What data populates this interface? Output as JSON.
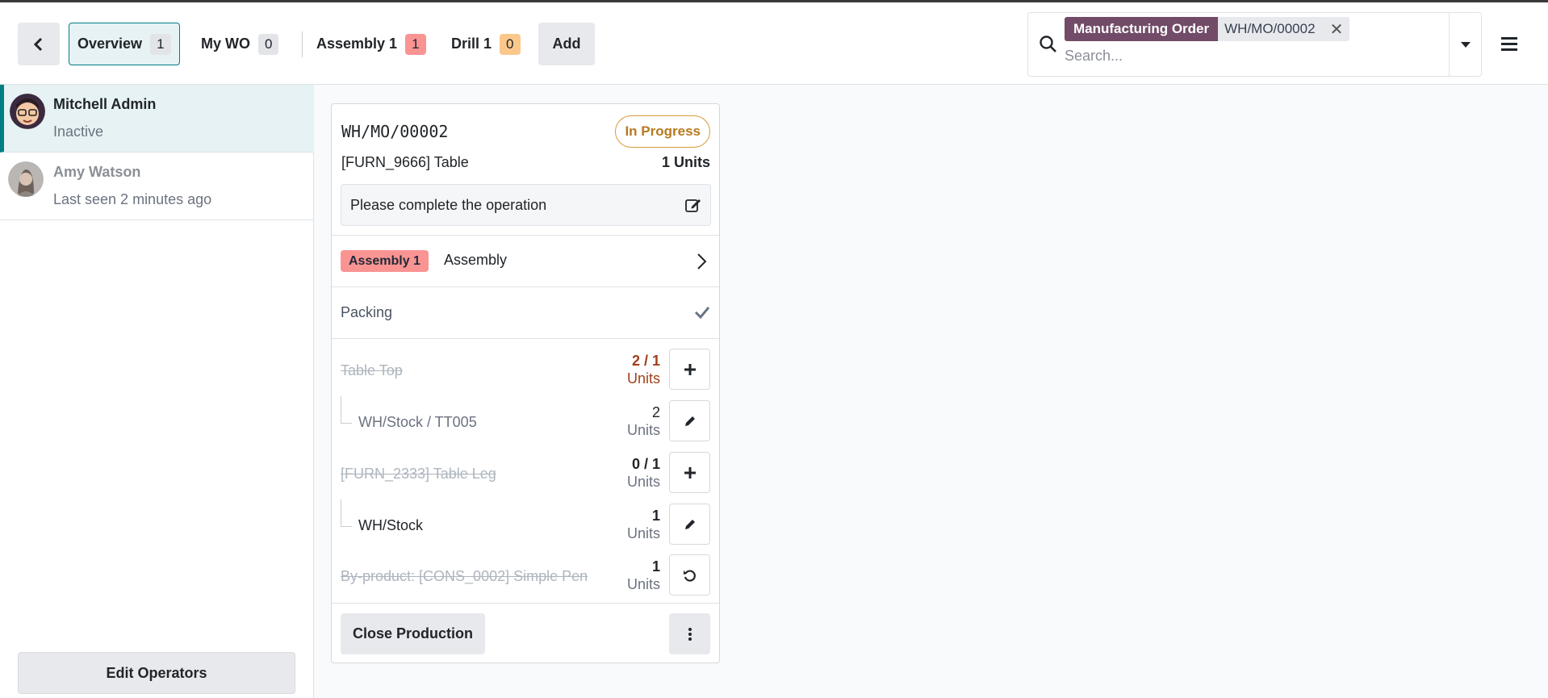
{
  "header": {
    "tabs": [
      {
        "label": "Overview",
        "count": "1"
      },
      {
        "label": "My WO",
        "count": "0"
      },
      {
        "label": "Assembly 1",
        "count": "1"
      },
      {
        "label": "Drill 1",
        "count": "0"
      }
    ],
    "add_label": "Add"
  },
  "search": {
    "facet_label": "Manufacturing Order",
    "facet_value": "WH/MO/00002",
    "placeholder": "Search..."
  },
  "operators": [
    {
      "name": "Mitchell Admin",
      "status": "Inactive"
    },
    {
      "name": "Amy Watson",
      "status": "Last seen 2 minutes ago"
    }
  ],
  "edit_operators_label": "Edit Operators",
  "card": {
    "name": "WH/MO/00002",
    "state": "In Progress",
    "product": "[FURN_9666] Table",
    "quantity": "1 Units",
    "instruction": "Please complete the operation",
    "workorder": {
      "tag": "Assembly 1",
      "name": "Assembly"
    },
    "step": "Packing",
    "components": [
      {
        "name": "Table Top",
        "qty": "2 / 1",
        "uom": "Units"
      },
      {
        "name": "WH/Stock / TT005",
        "qty": "2",
        "uom": "Units"
      },
      {
        "name": "[FURN_2333] Table Leg",
        "qty": "0 / 1",
        "uom": "Units"
      },
      {
        "name": "WH/Stock",
        "qty": "1",
        "uom": "Units"
      },
      {
        "name": "By-product: [CONS_0002] Simple Pen",
        "qty": "1",
        "uom": "Units"
      }
    ],
    "close_label": "Close Production"
  },
  "colors": {
    "accent": "#017e84",
    "brand": "#714b67",
    "badge_red": "#f99493",
    "badge_orange": "#fbc78b",
    "warn": "#a0401a"
  }
}
